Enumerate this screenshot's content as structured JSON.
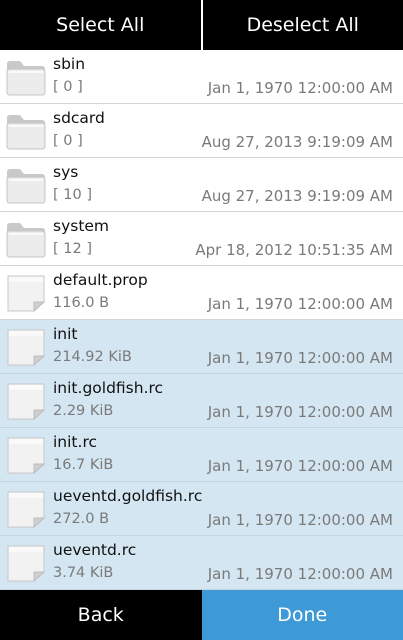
{
  "header": {
    "select_all": "Select All",
    "deselect_all": "Deselect All"
  },
  "files": [
    {
      "name": "sbin",
      "size": "[ 0 ]",
      "date": "Jan 1, 1970 12:00:00 AM",
      "icon": "folder-icon",
      "selected": false
    },
    {
      "name": "sdcard",
      "size": "[ 0 ]",
      "date": "Aug 27, 2013 9:19:09 AM",
      "icon": "folder-icon",
      "selected": false
    },
    {
      "name": "sys",
      "size": "[ 10 ]",
      "date": "Aug 27, 2013 9:19:09 AM",
      "icon": "folder-icon",
      "selected": false
    },
    {
      "name": "system",
      "size": "[ 12 ]",
      "date": "Apr 18, 2012 10:51:35 AM",
      "icon": "folder-icon",
      "selected": false
    },
    {
      "name": "default.prop",
      "size": "116.0 B",
      "date": "Jan 1, 1970 12:00:00 AM",
      "icon": "file-icon",
      "selected": false
    },
    {
      "name": "init",
      "size": "214.92 KiB",
      "date": "Jan 1, 1970 12:00:00 AM",
      "icon": "file-icon",
      "selected": true
    },
    {
      "name": "init.goldfish.rc",
      "size": "2.29 KiB",
      "date": "Jan 1, 1970 12:00:00 AM",
      "icon": "file-icon",
      "selected": true
    },
    {
      "name": "init.rc",
      "size": "16.7 KiB",
      "date": "Jan 1, 1970 12:00:00 AM",
      "icon": "file-icon",
      "selected": true
    },
    {
      "name": "ueventd.goldfish.rc",
      "size": "272.0 B",
      "date": "Jan 1, 1970 12:00:00 AM",
      "icon": "file-icon",
      "selected": true
    },
    {
      "name": "ueventd.rc",
      "size": "3.74 KiB",
      "date": "Jan 1, 1970 12:00:00 AM",
      "icon": "file-icon",
      "selected": true
    }
  ],
  "footer": {
    "back": "Back",
    "done": "Done"
  },
  "colors": {
    "selected_row": "#d4e6f2",
    "done_button": "#3d9ad6",
    "bars": "#000000"
  }
}
